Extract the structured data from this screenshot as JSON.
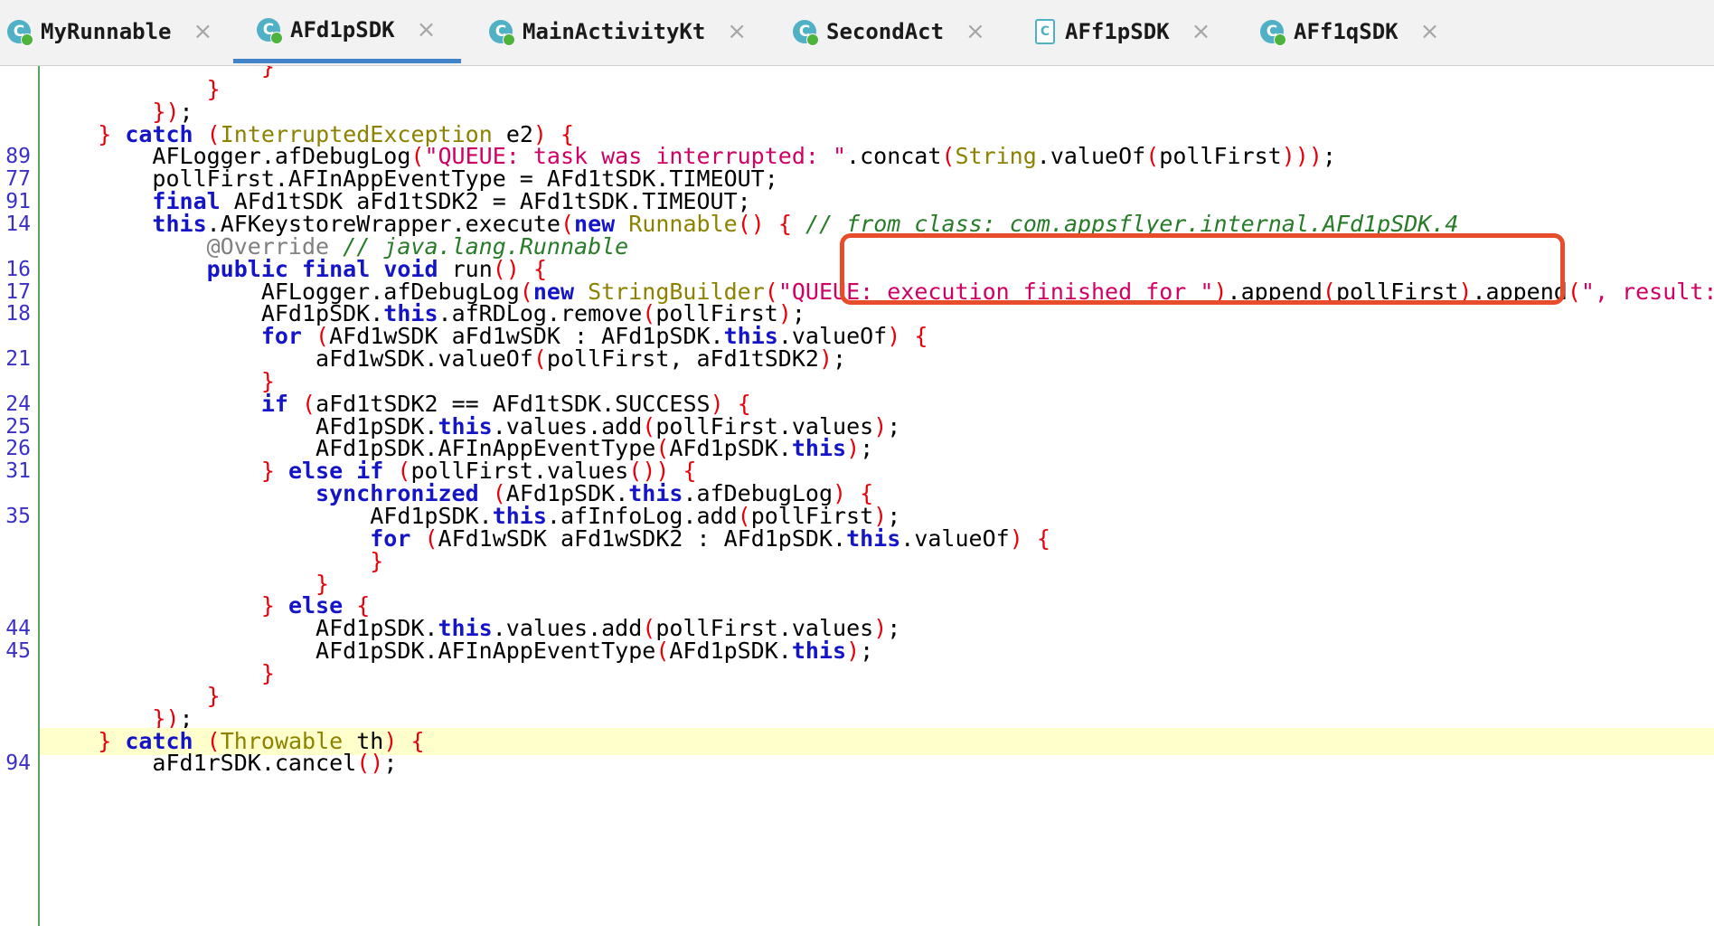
{
  "tabs": [
    {
      "label": "MyRunnable",
      "close": "×",
      "icon": "class-icon"
    },
    {
      "label": "AFd1pSDK",
      "close": "×",
      "icon": "class-icon"
    },
    {
      "label": "MainActivityKt",
      "close": "×",
      "icon": "class-icon"
    },
    {
      "label": "SecondAct",
      "close": "×",
      "icon": "class-icon"
    },
    {
      "label": "AFf1pSDK",
      "close": "×",
      "icon": "class-file-icon"
    },
    {
      "label": "AFf1qSDK",
      "close": "×",
      "icon": "class-icon"
    }
  ],
  "active_tab": "AFd1pSDK",
  "code_lines": [
    {
      "ln": "",
      "text": "                }"
    },
    {
      "ln": "",
      "text": "            }"
    },
    {
      "ln": "",
      "text": "        });"
    },
    {
      "ln": "",
      "text": "    } catch (InterruptedException e2) {"
    },
    {
      "ln": "89",
      "text": "        AFLogger.afDebugLog(\"QUEUE: task was interrupted: \".concat(String.valueOf(pollFirst)));"
    },
    {
      "ln": "77",
      "text": "        pollFirst.AFInAppEventType = AFd1tSDK.TIMEOUT;"
    },
    {
      "ln": "91",
      "text": "        final AFd1tSDK aFd1tSDK2 = AFd1tSDK.TIMEOUT;"
    },
    {
      "ln": "14",
      "text": "        this.AFKeystoreWrapper.execute(new Runnable() { // from class: com.appsflyer.internal.AFd1pSDK.4"
    },
    {
      "ln": "",
      "text": "            @Override // java.lang.Runnable"
    },
    {
      "ln": "16",
      "text": "            public final void run() {"
    },
    {
      "ln": "17",
      "text": "                AFLogger.afDebugLog(new StringBuilder(\"QUEUE: execution finished for \").append(pollFirst).append(\", result:"
    },
    {
      "ln": "18",
      "text": "                AFd1pSDK.this.afRDLog.remove(pollFirst);"
    },
    {
      "ln": "",
      "text": "                for (AFd1wSDK aFd1wSDK : AFd1pSDK.this.valueOf) {"
    },
    {
      "ln": "21",
      "text": "                    aFd1wSDK.valueOf(pollFirst, aFd1tSDK2);"
    },
    {
      "ln": "",
      "text": "                }"
    },
    {
      "ln": "24",
      "text": "                if (aFd1tSDK2 == AFd1tSDK.SUCCESS) {"
    },
    {
      "ln": "25",
      "text": "                    AFd1pSDK.this.values.add(pollFirst.values);"
    },
    {
      "ln": "26",
      "text": "                    AFd1pSDK.AFInAppEventType(AFd1pSDK.this);"
    },
    {
      "ln": "31",
      "text": "                } else if (pollFirst.values()) {"
    },
    {
      "ln": "",
      "text": "                    synchronized (AFd1pSDK.this.afDebugLog) {"
    },
    {
      "ln": "35",
      "text": "                        AFd1pSDK.this.afInfoLog.add(pollFirst);"
    },
    {
      "ln": "",
      "text": "                        for (AFd1wSDK aFd1wSDK2 : AFd1pSDK.this.valueOf) {"
    },
    {
      "ln": "",
      "text": "                        }"
    },
    {
      "ln": "",
      "text": "                    }"
    },
    {
      "ln": "",
      "text": "                } else {"
    },
    {
      "ln": "44",
      "text": "                    AFd1pSDK.this.values.add(pollFirst.values);"
    },
    {
      "ln": "45",
      "text": "                    AFd1pSDK.AFInAppEventType(AFd1pSDK.this);"
    },
    {
      "ln": "",
      "text": "                }"
    },
    {
      "ln": "",
      "text": "            }"
    },
    {
      "ln": "",
      "text": "        });"
    },
    {
      "ln": "",
      "text": "    } catch (Throwable th) {"
    },
    {
      "ln": "94",
      "text": "        aFd1rSDK.cancel();"
    }
  ],
  "highlighted_line": 30,
  "colors": {
    "keyword": "#1414c8",
    "string": "#d10064",
    "type": "#8c8200",
    "comment": "#287b28",
    "brace": "#e8000b",
    "line_number": "#3a30c8",
    "annotation_box": "#e84d2b",
    "highlight_bg": "#ffffcc",
    "tab_active_underline": "#4083c9"
  }
}
